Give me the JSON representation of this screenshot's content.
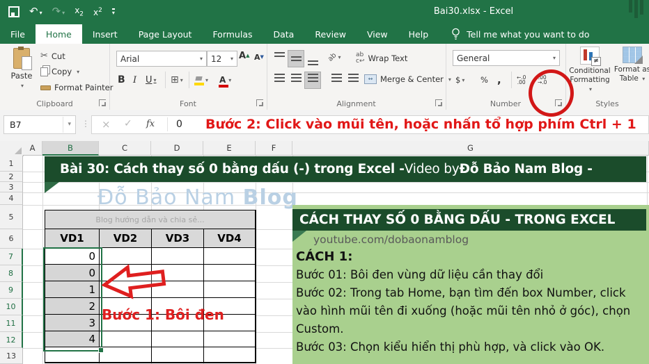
{
  "titlebar": {
    "title": "Bai30.xlsx  -  Excel",
    "qat": {
      "undo": "↶",
      "redo": "↷",
      "subscript": "x₂",
      "superscript": "x²"
    },
    "qat_icons": [
      "save-icon",
      "undo-icon",
      "redo-icon",
      "subscript-icon",
      "superscript-icon",
      "customize-qat-icon"
    ]
  },
  "tabs": {
    "items": [
      "File",
      "Home",
      "Insert",
      "Page Layout",
      "Formulas",
      "Data",
      "Review",
      "View",
      "Help"
    ],
    "active": "Home",
    "tellme": "Tell me what you want to do"
  },
  "ribbon": {
    "clipboard": {
      "label": "Clipboard",
      "paste": "Paste",
      "cut": "Cut",
      "copy": "Copy",
      "format_painter": "Format Painter"
    },
    "font": {
      "label": "Font",
      "family": "Arial",
      "size": "12",
      "bold": "B",
      "italic": "I",
      "underline": "U",
      "grow": "A",
      "shrink": "A",
      "border_icon": "⊞",
      "color_letter": "A"
    },
    "alignment": {
      "label": "Alignment",
      "orientation": "ab",
      "wrap_icon": "ab",
      "wrap": "Wrap Text",
      "merge": "Merge & Center"
    },
    "number": {
      "label": "Number",
      "format": "General",
      "currency": "$",
      "percent": "%",
      "comma": ","
    },
    "styles": {
      "label": "Styles",
      "cond1": "Conditional",
      "cond2": "Formatting",
      "fat1": "Format as",
      "fat2": "Table",
      "neq": "≠"
    }
  },
  "formula_bar": {
    "name_box": "B7",
    "cancel": "×",
    "enter": "✓",
    "fx": "fx",
    "value": "0",
    "annotation": "Bước 2: Click vào mũi tên, hoặc nhấn tổ hợp phím Ctrl + 1"
  },
  "sheet": {
    "col_headers": [
      "A",
      "B",
      "C",
      "D",
      "E",
      "F",
      "G"
    ],
    "row_headers": [
      "1",
      "2",
      "3",
      "4",
      "5",
      "6",
      "7",
      "8",
      "9",
      "10",
      "11",
      "12",
      "13"
    ],
    "banner": {
      "part1": "Bài 30: Cách thay số 0 bằng dấu (-) trong Excel - ",
      "part2": "Video by ",
      "part3": "Đỗ Bảo Nam Blog -"
    },
    "watermark": {
      "part1": "Đỗ Bảo Nam ",
      "part2": "Blog"
    },
    "table": {
      "subtitle": "Blog hướng dẫn và chia sẻ...",
      "headers": [
        "VD1",
        "VD2",
        "VD3",
        "VD4"
      ],
      "values": [
        "0",
        "0",
        "1",
        "2",
        "3",
        "4"
      ]
    },
    "step1": "Bước 1: Bôi đen"
  },
  "panel": {
    "title": "CÁCH THAY SỐ 0 BẰNG DẤU - TRONG EXCEL",
    "channel": "youtube.com/dobaonamblog",
    "method": "CÁCH 1:",
    "steps": [
      "Bước 01: Bôi đen vùng dữ liệu cần thay đổi",
      "Bước 02: Trong tab Home, bạn tìm đến box Number, click vào hình mũi tên đi xuống (hoặc mũi tên nhỏ ở góc), chọn Custom.",
      "Bước 03: Chọn kiểu hiển thị phù hợp, và click vào OK."
    ]
  },
  "colors": {
    "excel_green": "#217346",
    "banner_green": "#1b4c2b",
    "panel_green": "#a9d08e",
    "red": "#df1f1f"
  }
}
